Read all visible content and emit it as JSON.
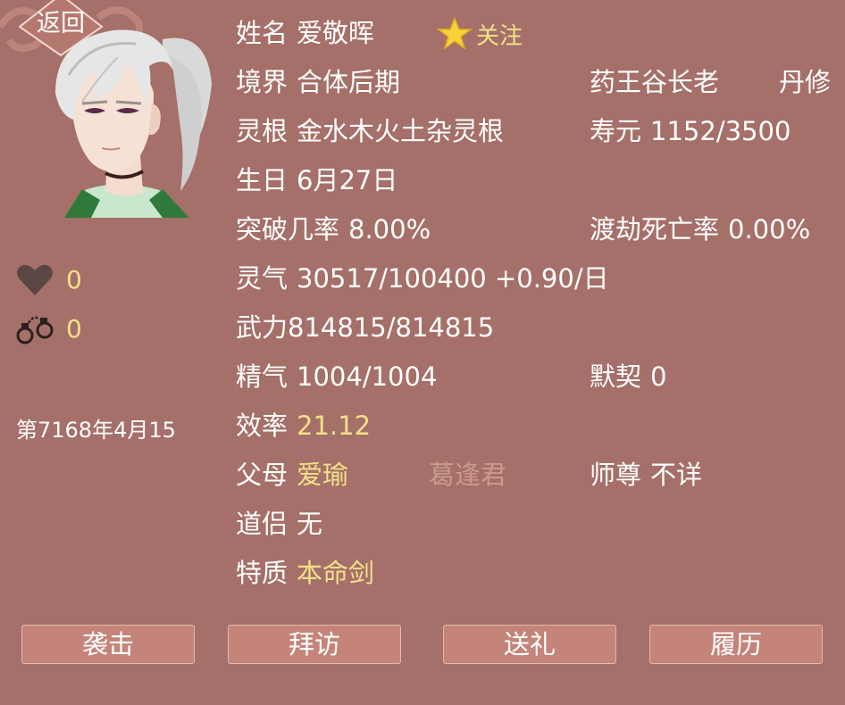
{
  "header": {
    "back_label": "返回",
    "follow_label": "关注"
  },
  "left": {
    "favor_value": "0",
    "bond_value": "0",
    "date": "第7168年4月15"
  },
  "profile": {
    "name_label": "姓名",
    "name_value": "爱敬晖",
    "realm_label": "境界",
    "realm_value": "合体后期",
    "sect_title": "药王谷长老",
    "profession": "丹修",
    "root_label": "灵根",
    "root_value": "金水木火土杂灵根",
    "lifespan_label": "寿元",
    "lifespan_value": "1152/3500",
    "birthday_label": "生日",
    "birthday_value": "6月27日",
    "breakthrough_label": "突破几率",
    "breakthrough_value": "8.00%",
    "tribulation_label": "渡劫死亡率",
    "tribulation_value": "0.00%",
    "qi_label": "灵气",
    "qi_value": "30517/100400 +0.90/日",
    "force_text": "武力814815/814815",
    "essence_label": "精气",
    "essence_value": "1004/1004",
    "rapport_label": "默契",
    "rapport_value": "0",
    "efficiency_label": "效率",
    "efficiency_value": "21.12",
    "parents_label": "父母",
    "parent1": "爱瑜",
    "parent2": "葛逢君",
    "master_label": "师尊",
    "master_value": "不详",
    "partner_label": "道侣",
    "partner_value": "无",
    "trait_label": "特质",
    "trait_value": "本命剑"
  },
  "actions": {
    "attack": "袭击",
    "visit": "拜访",
    "gift": "送礼",
    "history": "履历"
  },
  "colors": {
    "background": "#a57069",
    "highlight_text": "#f3e08a",
    "faded_text": "#c99a8e",
    "button_fill": "#c58479"
  },
  "icons": {
    "favor": "heart-icon",
    "bond": "handcuffs-icon",
    "follow": "star-icon"
  }
}
